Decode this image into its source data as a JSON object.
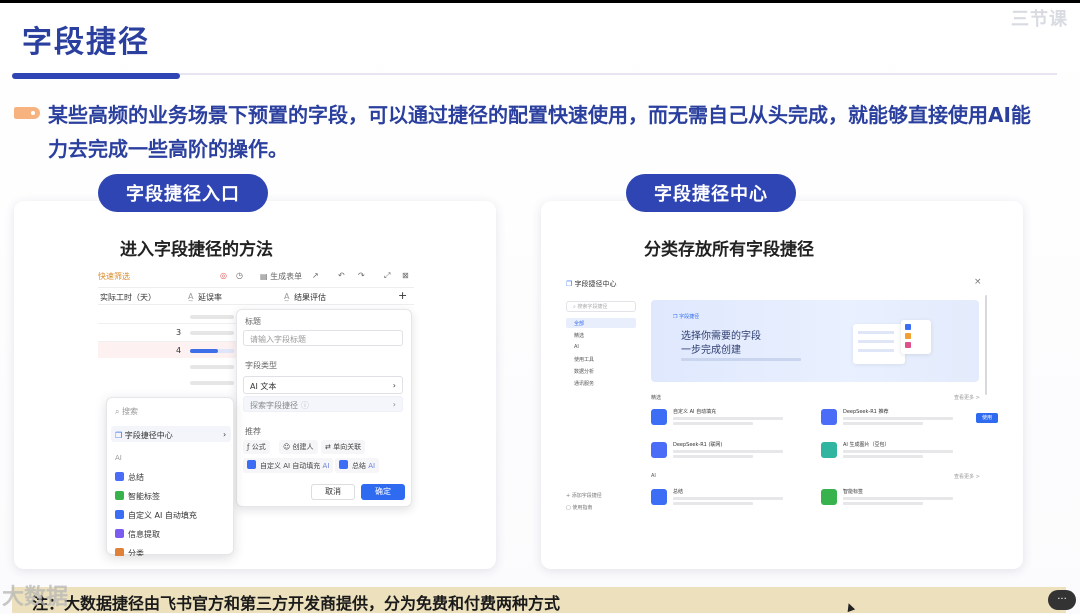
{
  "slide": {
    "brand": "三节课",
    "title": "字段捷径",
    "description": "某些高频的业务场景下预置的字段，可以通过捷径的配置快速使用，而无需自己从头完成，就能够直接使用AI能力去完成一些高阶的操作。",
    "left_pill": "字段捷径入口",
    "right_pill": "字段捷径中心",
    "left_card_subtitle": "进入字段捷径的方法",
    "right_card_subtitle": "分类存放所有字段捷径",
    "note": "注：大数据捷径由飞书官方和第三方开发商提供，分为免费和付费两种方式",
    "watermark": "大数据",
    "more_button": "···"
  },
  "left_mock": {
    "toolbar": {
      "tag": "快速筛选",
      "gen_form": "生成表单"
    },
    "columns": [
      "实际工时（天）",
      "延误率",
      "结果评估"
    ],
    "rows": [
      "3",
      "4"
    ],
    "panel": {
      "title_label": "标题",
      "title_placeholder": "请输入字段标题",
      "type_label": "字段类型",
      "type_value": "AI 文本",
      "explore": "探索字段捷径",
      "recommend_label": "推荐",
      "chips": [
        "公式",
        "创建人",
        "单向关联",
        "自定义 AI 自动填充",
        "总结"
      ],
      "chip_badge": "AI",
      "cancel": "取消",
      "confirm": "确定"
    },
    "dropdown": {
      "search_placeholder": "搜索",
      "center": "字段捷径中心",
      "section": "AI",
      "items": [
        "总结",
        "智能标签",
        "自定义 AI 自动填充",
        "信息提取",
        "分类"
      ]
    }
  },
  "right_mock": {
    "title": "字段捷径中心",
    "close": "×",
    "search_placeholder": "搜索字段捷径",
    "nav": [
      "全部",
      "精选",
      "AI",
      "使用工具",
      "数据分析",
      "通讯服务"
    ],
    "banner": {
      "tag": "字段捷径",
      "heading": "选择你需要的字段",
      "subheading": "一步完成创建"
    },
    "sec1": "精选",
    "sec2": "AI",
    "more": "查看更多 >",
    "items": [
      {
        "name": "自定义 AI 自动填充",
        "color": "#3b6ef5"
      },
      {
        "name": "DeepSeek-R1 推荐",
        "color": "#4a6cf7"
      },
      {
        "name": "DeepSeek-R1 (联网)",
        "color": "#4a6cf7"
      },
      {
        "name": "AI 生成图片（豆包）",
        "color": "#2fb5a0"
      },
      {
        "name": "总结",
        "color": "#3b6ef5"
      },
      {
        "name": "智能标签",
        "color": "#37b24d"
      }
    ],
    "use": "使用",
    "footer": [
      "添加字段捷径",
      "使用指南"
    ]
  }
}
